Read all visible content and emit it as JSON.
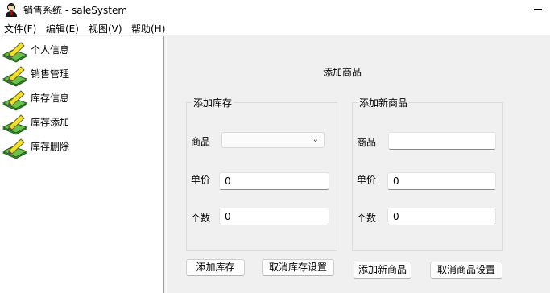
{
  "window": {
    "title": "销售系统 - saleSystem"
  },
  "menu": [
    "文件(F)",
    "编辑(E)",
    "视图(V)",
    "帮助(H)"
  ],
  "sidebar": {
    "items": [
      {
        "label": "个人信息"
      },
      {
        "label": "销售管理"
      },
      {
        "label": "库存信息"
      },
      {
        "label": "库存添加"
      },
      {
        "label": "库存删除"
      }
    ]
  },
  "main": {
    "title": "添加商品",
    "add_stock": {
      "title": "添加库存",
      "product_label": "商品",
      "product_value": "",
      "price_label": "单价",
      "price_value": "0",
      "qty_label": "个数",
      "qty_value": "0",
      "add_button": "添加库存",
      "cancel_button": "取消库存设置"
    },
    "add_product": {
      "title": "添加新商品",
      "product_label": "商品",
      "product_value": "",
      "price_label": "单价",
      "price_value": "0",
      "qty_label": "个数",
      "qty_value": "0",
      "add_button": "添加新商品",
      "cancel_button": "取消商品设置"
    }
  },
  "colors": {
    "window_bg": "#f0f0f0",
    "sidebar_bg": "#ffffff",
    "icon_green": "#3c9a2e",
    "icon_yellow": "#f2e02a"
  }
}
